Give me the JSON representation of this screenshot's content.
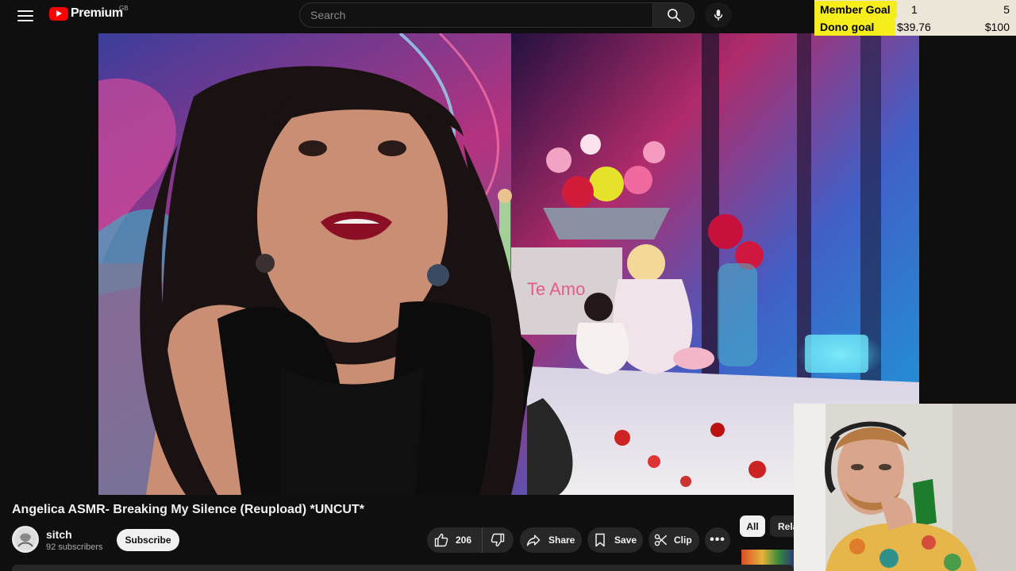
{
  "header": {
    "logo_text": "Premium",
    "region": "GB",
    "search_placeholder": "Search"
  },
  "goals": {
    "member": {
      "label": "Member Goal",
      "current": "1",
      "target": "5"
    },
    "donation": {
      "label": "Dono goal",
      "current": "$39.76",
      "target": "$100"
    }
  },
  "video": {
    "title": "Angelica ASMR- Breaking My Silence (Reupload) *UNCUT*"
  },
  "channel": {
    "name": "sitch",
    "subscribers": "92 subscribers",
    "subscribe_label": "Subscribe"
  },
  "actions": {
    "likes": "206",
    "share_label": "Share",
    "save_label": "Save",
    "clip_label": "Clip",
    "more_label": "•••"
  },
  "chips": {
    "all": "All",
    "related": "Related"
  },
  "icons": {
    "menu": "menu-icon",
    "search": "search-icon",
    "mic": "mic-icon",
    "like": "thumbs-up-icon",
    "dislike": "thumbs-down-icon",
    "share": "share-arrow-icon",
    "save": "bookmark-icon",
    "clip": "scissors-icon"
  },
  "colors": {
    "background": "#0f0f0f",
    "brand_red": "#ff0000",
    "goal_yellow": "#f6ee1c",
    "pill": "#272727"
  }
}
